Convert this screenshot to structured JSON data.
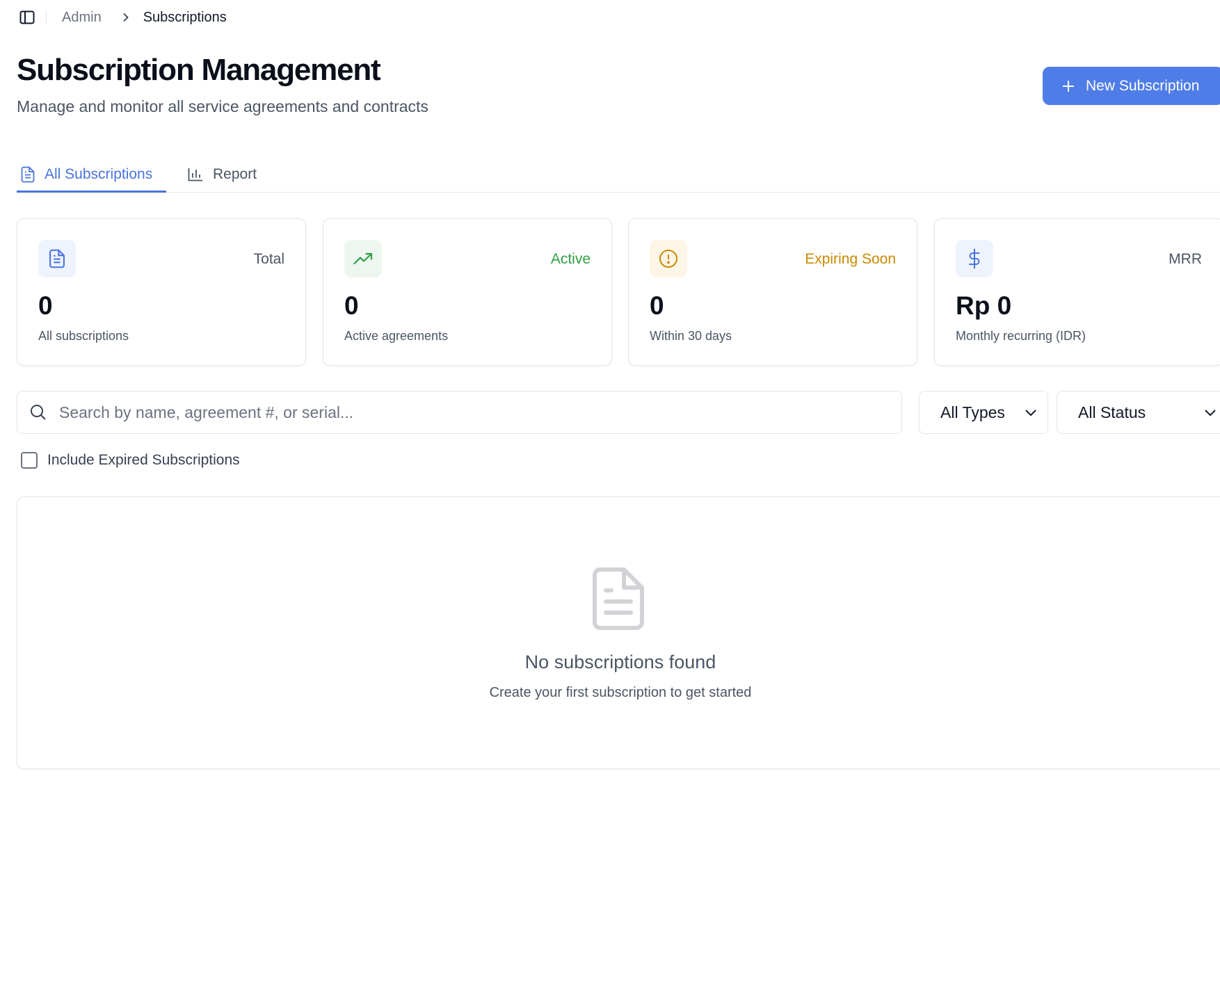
{
  "breadcrumb": {
    "parent": "Admin",
    "current": "Subscriptions"
  },
  "header": {
    "title": "Subscription Management",
    "subtitle": "Manage and monitor all service agreements and contracts",
    "new_button_label": "New Subscription"
  },
  "tabs": [
    {
      "label": "All Subscriptions",
      "icon": "document-icon",
      "active": true
    },
    {
      "label": "Report",
      "icon": "bar-chart-icon",
      "active": false
    }
  ],
  "stats": [
    {
      "label": "Total",
      "value": "0",
      "description": "All subscriptions",
      "icon": "document-icon",
      "accent": "#4a74dc",
      "bg": "#eef3fd",
      "label_color": "#4b5563"
    },
    {
      "label": "Active",
      "value": "0",
      "description": "Active agreements",
      "icon": "trending-up-icon",
      "accent": "#2f9e44",
      "bg": "#eef6f0",
      "label_color": "#2f9e44"
    },
    {
      "label": "Expiring Soon",
      "value": "0",
      "description": "Within 30 days",
      "icon": "alert-circle-icon",
      "accent": "#c98a00",
      "bg": "#fdf6e7",
      "label_color": "#c98a00"
    },
    {
      "label": "MRR",
      "value": "Rp 0",
      "description": "Monthly recurring (IDR)",
      "icon": "dollar-icon",
      "accent": "#4a74dc",
      "bg": "#eef3fd",
      "label_color": "#4b5563"
    }
  ],
  "filters": {
    "search_placeholder": "Search by name, agreement #, or serial...",
    "search_value": "",
    "type_select": "All Types",
    "status_select": "All Status",
    "include_expired_label": "Include Expired Subscriptions",
    "include_expired_checked": false
  },
  "empty_state": {
    "title": "No subscriptions found",
    "description": "Create your first subscription to get started"
  },
  "colors": {
    "primary": "#4f7de8",
    "tab_active": "#4a74dc",
    "border": "#e2e5ea"
  }
}
